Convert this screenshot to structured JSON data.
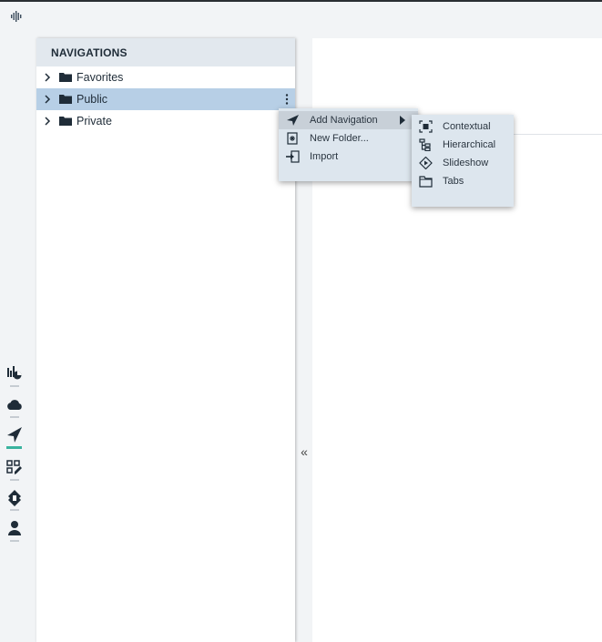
{
  "app": {
    "logo_icon": "waveform-logo-icon"
  },
  "rail": {
    "items": [
      {
        "name": "charts",
        "icon": "chart-pie-icon"
      },
      {
        "name": "cloud",
        "icon": "cloud-icon"
      },
      {
        "name": "navigations",
        "icon": "paper-plane-icon",
        "active": true
      },
      {
        "name": "layouts",
        "icon": "grid-edit-icon"
      },
      {
        "name": "tools",
        "icon": "puzzle-icon"
      },
      {
        "name": "users",
        "icon": "user-icon"
      }
    ],
    "active_color": "#39b39e"
  },
  "navigations": {
    "header": "NAVIGATIONS",
    "items": [
      {
        "label": "Favorites",
        "selected": false
      },
      {
        "label": "Public",
        "selected": true
      },
      {
        "label": "Private",
        "selected": false
      }
    ]
  },
  "collapse_glyph": "«",
  "context_menu": {
    "items": [
      {
        "label": "Add Navigation",
        "icon": "paper-plane-icon",
        "submenu": true
      },
      {
        "label": "New Folder...",
        "icon": "new-folder-icon"
      },
      {
        "label": "Import",
        "icon": "import-icon"
      }
    ]
  },
  "submenu": {
    "items": [
      {
        "label": "Contextual",
        "icon": "contextual-icon"
      },
      {
        "label": "Hierarchical",
        "icon": "hierarchical-icon"
      },
      {
        "label": "Slideshow",
        "icon": "slideshow-icon"
      },
      {
        "label": "Tabs",
        "icon": "tabs-icon"
      }
    ]
  },
  "colors": {
    "selection": "#b7cfe6",
    "menu_bg": "#dde6ee",
    "header_bg": "#e2e8ee"
  }
}
